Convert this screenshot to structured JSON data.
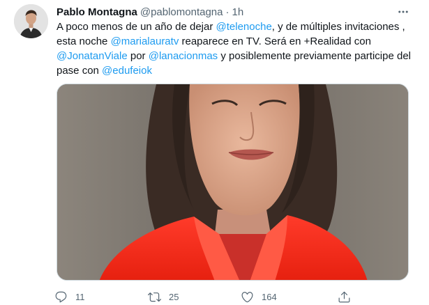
{
  "author": {
    "name": "Pablo Montagna",
    "handle": "@pablomontagna",
    "separator": "·",
    "time": "1h"
  },
  "tweet": {
    "line1_pre": "A poco menos de un año de dejar ",
    "m_telenoche": "@telenoche",
    "line1_post": ", y de múltiples invitaciones ,",
    "line2_pre": "esta noche ",
    "m_marialauratv": "@marialauratv",
    "line2_post": " reaparece en TV. Será en +Realidad con",
    "m_jonatanviale": "@JonatanViale",
    "line3_mid": " por ",
    "m_lanacionmas": "@lanacionmas",
    "line3_post": " y posiblemente previamente participe del",
    "line4_pre": "pase con ",
    "m_edufeiok": "@edufeiok"
  },
  "actions": {
    "reply_count": "11",
    "retweet_count": "25",
    "like_count": "164"
  },
  "icons": {
    "more": "more-horizontal-icon",
    "reply": "reply-icon",
    "retweet": "retweet-icon",
    "like": "heart-icon",
    "share": "share-icon"
  },
  "colors": {
    "link": "#1d9bf0",
    "secondary_text": "#536471",
    "primary_text": "#0f1419"
  }
}
